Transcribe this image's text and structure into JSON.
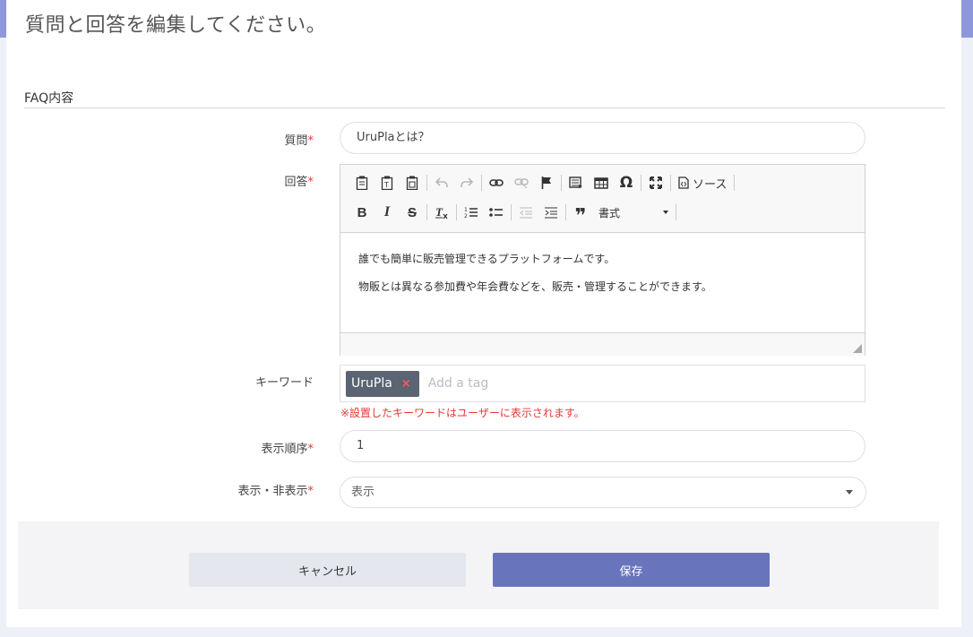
{
  "page": {
    "title": "質問と回答を編集してください。",
    "section_title": "FAQ内容"
  },
  "form": {
    "question": {
      "label": "質問",
      "required_mark": "*",
      "value": "UruPlaとは？"
    },
    "answer": {
      "label": "回答",
      "required_mark": "*",
      "toolbar": {
        "source_label": "ソース",
        "format_label": "書式"
      },
      "content": [
        "誰でも簡単に販売管理できるプラットフォームです。",
        "物販とは異なる参加費や年会費などを、販売・管理することができます。"
      ]
    },
    "keywords": {
      "label": "キーワード",
      "tags": [
        "UruPla"
      ],
      "remove_symbol": "×",
      "placeholder": "Add a tag",
      "hint": "※設置したキーワードはユーザーに表示されます。"
    },
    "order": {
      "label": "表示順序",
      "required_mark": "*",
      "value": "1"
    },
    "visibility": {
      "label": "表示・非表示",
      "required_mark": "*",
      "selected": "表示"
    }
  },
  "actions": {
    "cancel_label": "キャンセル",
    "save_label": "保存"
  },
  "colors": {
    "accent": "#8f97dc",
    "primary_button": "#6874bb",
    "required": "#e53935",
    "tag_chip": "#5a6472"
  }
}
